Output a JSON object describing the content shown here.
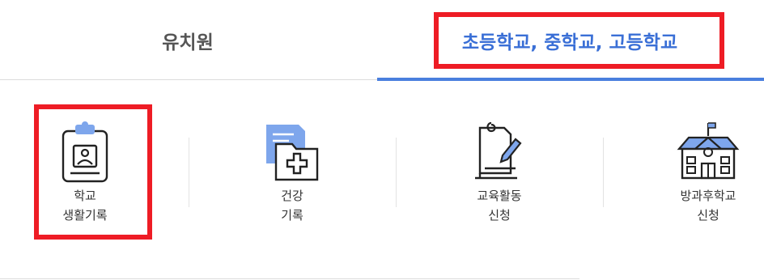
{
  "tabs": [
    {
      "label": "유치원",
      "active": false
    },
    {
      "label": "초등학교, 중학교, 고등학교",
      "active": true
    }
  ],
  "colors": {
    "active_tab": "#3a6fd6",
    "highlight": "#ee1c25",
    "icon_blue": "#7ea6ec"
  },
  "menu": [
    {
      "line1": "학교",
      "line2": "생활기록",
      "icon": "clipboard-profile-icon"
    },
    {
      "line1": "건강",
      "line2": "기록",
      "icon": "medical-folder-icon"
    },
    {
      "line1": "교육활동",
      "line2": "신청",
      "icon": "notebook-pencil-icon"
    },
    {
      "line1": "방과후학교",
      "line2": "신청",
      "icon": "school-building-icon"
    }
  ]
}
